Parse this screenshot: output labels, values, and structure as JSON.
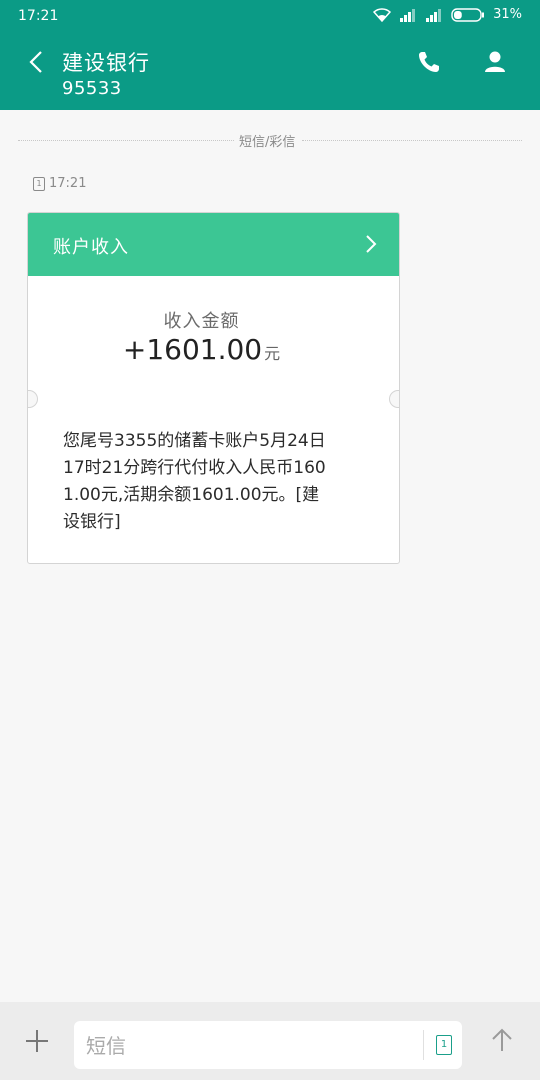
{
  "status_bar": {
    "time": "17:21",
    "battery_percent": "31%",
    "battery_level": 0.31
  },
  "header": {
    "title": "建设银行",
    "subtitle": "95533"
  },
  "thread": {
    "separator_label": "短信/彩信",
    "sim_label": "1",
    "message_time": "17:21"
  },
  "card": {
    "header_title": "账户收入",
    "amount_label": "收入金额",
    "amount_value": "+1601.00",
    "amount_unit": "元",
    "message_text": "您尾号3355的储蓄卡账户5月24日17时21分跨行代付收入人民币1601.00元,活期余额1601.00元。[建设银行]"
  },
  "composer": {
    "placeholder": "短信",
    "sim_label": "1"
  },
  "colors": {
    "header_bg": "#0b9b86",
    "card_header_bg": "#3cc694",
    "accent": "#1a9f8a"
  }
}
